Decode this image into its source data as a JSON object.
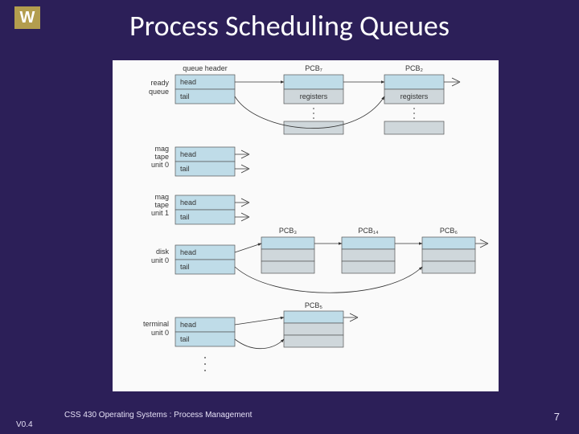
{
  "logo": "W",
  "title": "Process Scheduling Queues",
  "footer": {
    "version": "V0.4",
    "course": "CSS 430 Operating Systems : Process Management",
    "page": "7"
  },
  "diagram": {
    "column_headers": {
      "queue": "queue header",
      "pcb7": "PCB₇",
      "pcb2": "PCB₂"
    },
    "queues": [
      {
        "name": "ready queue",
        "head": "head",
        "tail": "tail"
      },
      {
        "name": "mag tape unit 0",
        "head": "head",
        "tail": "tail"
      },
      {
        "name": "mag tape unit 1",
        "head": "head",
        "tail": "tail"
      },
      {
        "name": "disk unit 0",
        "head": "head",
        "tail": "tail"
      },
      {
        "name": "terminal unit 0",
        "head": "head",
        "tail": "tail"
      }
    ],
    "registers_label": "registers",
    "pcb_labels": {
      "r1c1": "PCB₇",
      "r1c2": "PCB₂",
      "r3c1": "PCB₃",
      "r3c2": "PCB₁₄",
      "r3c3": "PCB₆",
      "r5c1": "PCB₅"
    }
  }
}
